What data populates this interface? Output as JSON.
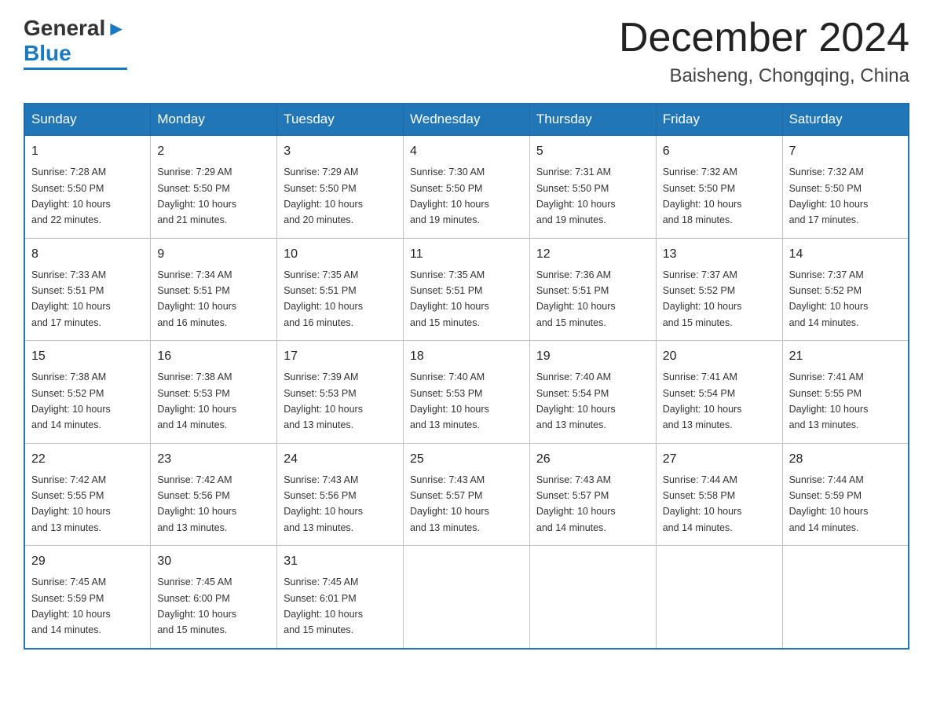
{
  "header": {
    "logo": {
      "general": "General",
      "arrow": "▶",
      "blue": "Blue"
    },
    "title": "December 2024",
    "subtitle": "Baisheng, Chongqing, China"
  },
  "weekdays": [
    "Sunday",
    "Monday",
    "Tuesday",
    "Wednesday",
    "Thursday",
    "Friday",
    "Saturday"
  ],
  "weeks": [
    [
      {
        "day": "1",
        "sunrise": "7:28 AM",
        "sunset": "5:50 PM",
        "daylight": "10 hours and 22 minutes."
      },
      {
        "day": "2",
        "sunrise": "7:29 AM",
        "sunset": "5:50 PM",
        "daylight": "10 hours and 21 minutes."
      },
      {
        "day": "3",
        "sunrise": "7:29 AM",
        "sunset": "5:50 PM",
        "daylight": "10 hours and 20 minutes."
      },
      {
        "day": "4",
        "sunrise": "7:30 AM",
        "sunset": "5:50 PM",
        "daylight": "10 hours and 19 minutes."
      },
      {
        "day": "5",
        "sunrise": "7:31 AM",
        "sunset": "5:50 PM",
        "daylight": "10 hours and 19 minutes."
      },
      {
        "day": "6",
        "sunrise": "7:32 AM",
        "sunset": "5:50 PM",
        "daylight": "10 hours and 18 minutes."
      },
      {
        "day": "7",
        "sunrise": "7:32 AM",
        "sunset": "5:50 PM",
        "daylight": "10 hours and 17 minutes."
      }
    ],
    [
      {
        "day": "8",
        "sunrise": "7:33 AM",
        "sunset": "5:51 PM",
        "daylight": "10 hours and 17 minutes."
      },
      {
        "day": "9",
        "sunrise": "7:34 AM",
        "sunset": "5:51 PM",
        "daylight": "10 hours and 16 minutes."
      },
      {
        "day": "10",
        "sunrise": "7:35 AM",
        "sunset": "5:51 PM",
        "daylight": "10 hours and 16 minutes."
      },
      {
        "day": "11",
        "sunrise": "7:35 AM",
        "sunset": "5:51 PM",
        "daylight": "10 hours and 15 minutes."
      },
      {
        "day": "12",
        "sunrise": "7:36 AM",
        "sunset": "5:51 PM",
        "daylight": "10 hours and 15 minutes."
      },
      {
        "day": "13",
        "sunrise": "7:37 AM",
        "sunset": "5:52 PM",
        "daylight": "10 hours and 15 minutes."
      },
      {
        "day": "14",
        "sunrise": "7:37 AM",
        "sunset": "5:52 PM",
        "daylight": "10 hours and 14 minutes."
      }
    ],
    [
      {
        "day": "15",
        "sunrise": "7:38 AM",
        "sunset": "5:52 PM",
        "daylight": "10 hours and 14 minutes."
      },
      {
        "day": "16",
        "sunrise": "7:38 AM",
        "sunset": "5:53 PM",
        "daylight": "10 hours and 14 minutes."
      },
      {
        "day": "17",
        "sunrise": "7:39 AM",
        "sunset": "5:53 PM",
        "daylight": "10 hours and 13 minutes."
      },
      {
        "day": "18",
        "sunrise": "7:40 AM",
        "sunset": "5:53 PM",
        "daylight": "10 hours and 13 minutes."
      },
      {
        "day": "19",
        "sunrise": "7:40 AM",
        "sunset": "5:54 PM",
        "daylight": "10 hours and 13 minutes."
      },
      {
        "day": "20",
        "sunrise": "7:41 AM",
        "sunset": "5:54 PM",
        "daylight": "10 hours and 13 minutes."
      },
      {
        "day": "21",
        "sunrise": "7:41 AM",
        "sunset": "5:55 PM",
        "daylight": "10 hours and 13 minutes."
      }
    ],
    [
      {
        "day": "22",
        "sunrise": "7:42 AM",
        "sunset": "5:55 PM",
        "daylight": "10 hours and 13 minutes."
      },
      {
        "day": "23",
        "sunrise": "7:42 AM",
        "sunset": "5:56 PM",
        "daylight": "10 hours and 13 minutes."
      },
      {
        "day": "24",
        "sunrise": "7:43 AM",
        "sunset": "5:56 PM",
        "daylight": "10 hours and 13 minutes."
      },
      {
        "day": "25",
        "sunrise": "7:43 AM",
        "sunset": "5:57 PM",
        "daylight": "10 hours and 13 minutes."
      },
      {
        "day": "26",
        "sunrise": "7:43 AM",
        "sunset": "5:57 PM",
        "daylight": "10 hours and 14 minutes."
      },
      {
        "day": "27",
        "sunrise": "7:44 AM",
        "sunset": "5:58 PM",
        "daylight": "10 hours and 14 minutes."
      },
      {
        "day": "28",
        "sunrise": "7:44 AM",
        "sunset": "5:59 PM",
        "daylight": "10 hours and 14 minutes."
      }
    ],
    [
      {
        "day": "29",
        "sunrise": "7:45 AM",
        "sunset": "5:59 PM",
        "daylight": "10 hours and 14 minutes."
      },
      {
        "day": "30",
        "sunrise": "7:45 AM",
        "sunset": "6:00 PM",
        "daylight": "10 hours and 15 minutes."
      },
      {
        "day": "31",
        "sunrise": "7:45 AM",
        "sunset": "6:01 PM",
        "daylight": "10 hours and 15 minutes."
      },
      null,
      null,
      null,
      null
    ]
  ],
  "labels": {
    "sunrise_prefix": "Sunrise: ",
    "sunset_prefix": "Sunset: ",
    "daylight_prefix": "Daylight: "
  }
}
